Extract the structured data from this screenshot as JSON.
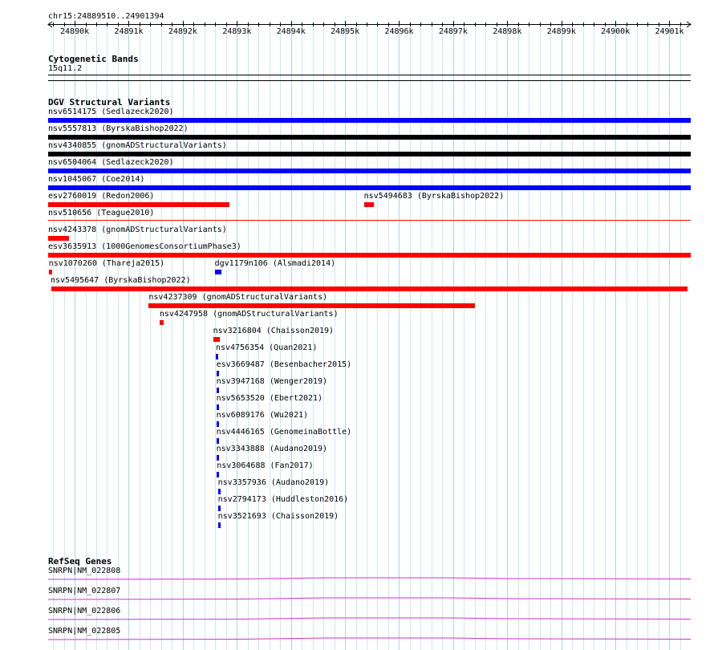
{
  "view": {
    "region": "chr15:24889510..24901394",
    "start": 24889510,
    "end": 24901394
  },
  "ruler": {
    "ticks": [
      "24890k",
      "24891k",
      "24892k",
      "24893k",
      "24894k",
      "24895k",
      "24896k",
      "24897k",
      "24898k",
      "24899k",
      "24900k",
      "24901k"
    ]
  },
  "cytobands": {
    "title": "Cytogenetic Bands",
    "label": "15q11.2"
  },
  "dgv": {
    "title": "DGV Structural Variants",
    "features": [
      {
        "name": "nsv6514175 (Sedlazeck2020)",
        "start": 24889510,
        "end": 24901394,
        "color": "#0000ff"
      },
      {
        "name": "nsv5557813 (ByrskaBishop2022)",
        "start": 24889510,
        "end": 24901394,
        "color": "#000000"
      },
      {
        "name": "nsv4340855 (gnomADStructuralVariants)",
        "start": 24889510,
        "end": 24901394,
        "color": "#000000"
      },
      {
        "name": "nsv6504064 (Sedlazeck2020)",
        "start": 24889510,
        "end": 24901394,
        "color": "#0000ff"
      },
      {
        "name": "nsv1045067 (Coe2014)",
        "start": 24889510,
        "end": 24901394,
        "color": "#0000ff"
      },
      {
        "name": "esv2760019 (Redon2006)",
        "start": 24889510,
        "end": 24892860,
        "color": "#ff0000"
      },
      {
        "name": "nsv5494683 (ByrskaBishop2022)",
        "start": 24895350,
        "end": 24895540,
        "color": "#ff0000"
      },
      {
        "name": "nsv510656 (Teague2010)",
        "start": 24889510,
        "end": 24901394,
        "color": "#ff0000"
      },
      {
        "name": "nsv4243378 (gnomADStructuralVariants)",
        "start": 24889510,
        "end": 24889890,
        "color": "#ff0000"
      },
      {
        "name": "esv3635913 (1000GenomesConsortiumPhase3)",
        "start": 24889510,
        "end": 24901394,
        "color": "#ff0000"
      },
      {
        "name": "nsv1070260 (Thareja2015)",
        "start": 24889520,
        "end": 24889580,
        "color": "#ff0000"
      },
      {
        "name": "dgv1179n106 (Alsmadi2014)",
        "start": 24892590,
        "end": 24892710,
        "color": "#0000ff"
      },
      {
        "name": "nsv5495647 (ByrskaBishop2022)",
        "start": 24889570,
        "end": 24901340,
        "color": "#ff0000"
      },
      {
        "name": "nsv4237309 (gnomADStructuralVariants)",
        "start": 24891370,
        "end": 24897400,
        "color": "#ff0000"
      },
      {
        "name": "nsv4247958 (gnomADStructuralVariants)",
        "start": 24891570,
        "end": 24891640,
        "color": "#ff0000"
      },
      {
        "name": "nsv3216804 (Chaisson2019)",
        "start": 24892560,
        "end": 24892680,
        "color": "#ff0000"
      },
      {
        "name": "nsv4756354 (Quan2021)",
        "start": 24892610,
        "end": 24892640,
        "color": "#0000ff"
      },
      {
        "name": "esv3669487 (Besenbacher2015)",
        "start": 24892620,
        "end": 24892650,
        "color": "#0000ff"
      },
      {
        "name": "nsv3947168 (Wenger2019)",
        "start": 24892620,
        "end": 24892650,
        "color": "#0000ff"
      },
      {
        "name": "nsv5653520 (Ebert2021)",
        "start": 24892620,
        "end": 24892650,
        "color": "#0000ff"
      },
      {
        "name": "nsv6089176 (Wu2021)",
        "start": 24892620,
        "end": 24892650,
        "color": "#0000ff"
      },
      {
        "name": "nsv4446165 (GenomeinaBottle)",
        "start": 24892620,
        "end": 24892650,
        "color": "#0000ff"
      },
      {
        "name": "nsv3343888 (Audano2019)",
        "start": 24892620,
        "end": 24892650,
        "color": "#0000ff"
      },
      {
        "name": "nsv3064688 (Fan2017)",
        "start": 24892630,
        "end": 24892660,
        "color": "#0000ff"
      },
      {
        "name": "nsv3357936 (Audano2019)",
        "start": 24892650,
        "end": 24892680,
        "color": "#0000ff"
      },
      {
        "name": "nsv2794173 (Huddleston2016)",
        "start": 24892650,
        "end": 24892680,
        "color": "#0000ff"
      },
      {
        "name": "nsv3521693 (Chaisson2019)",
        "start": 24892650,
        "end": 24892680,
        "color": "#0000ff"
      }
    ]
  },
  "refseq": {
    "title": "RefSeq Genes",
    "genes": [
      {
        "name": "SNRPN|NM_022808",
        "color": "#cc33cc"
      },
      {
        "name": "SNRPN|NM_022807",
        "color": "#cc33cc"
      },
      {
        "name": "SNRPN|NM_022806",
        "color": "#cc33cc"
      },
      {
        "name": "SNRPN|NM_022805",
        "color": "#cc33cc"
      }
    ]
  },
  "colors": {
    "grid": "#a8d8e8",
    "axis": "#000000"
  }
}
